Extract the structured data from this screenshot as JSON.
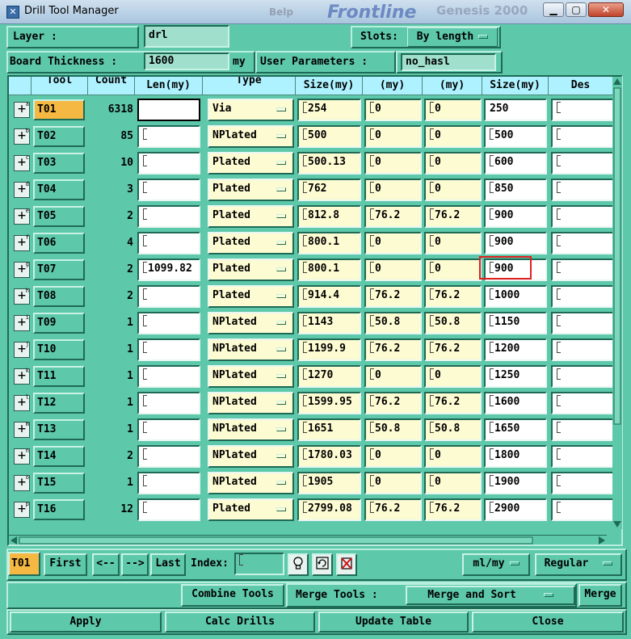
{
  "window": {
    "title": "Drill Tool Manager",
    "brand_small": "Belp",
    "brand": "Frontline",
    "brand2": "Genesis 2000"
  },
  "header": {
    "layer_label": "Layer          :",
    "layer_value": "drl",
    "slots_label": "Slots:",
    "slots_value": "By length",
    "thickness_label": "Board Thickness :",
    "thickness_value": "1600",
    "thickness_unit": "my",
    "user_params_label": "User Parameters :",
    "user_params_value": "no_hasl"
  },
  "table": {
    "headers": {
      "tool": "Tool",
      "count": "Count",
      "len": "Len(my)",
      "type": "Type",
      "size": "Size(my)",
      "tol1": "(my)",
      "tol2": "(my)",
      "finish": "Size(my)",
      "des": "Des"
    },
    "rows": [
      {
        "marker": "a",
        "tool": "T01",
        "count": "6318",
        "len": "",
        "type": "Via",
        "size": "254",
        "tol1": "0",
        "tol2": "0",
        "finish": "250",
        "des": ""
      },
      {
        "marker": "b",
        "tool": "T02",
        "count": "85",
        "len": "",
        "type": "NPlated",
        "size": "500",
        "tol1": "0",
        "tol2": "0",
        "finish": "500",
        "des": ""
      },
      {
        "marker": "c",
        "tool": "T03",
        "count": "10",
        "len": "",
        "type": "Plated",
        "size": "500.13",
        "tol1": "0",
        "tol2": "0",
        "finish": "600",
        "des": ""
      },
      {
        "marker": "d",
        "tool": "T04",
        "count": "3",
        "len": "",
        "type": "Plated",
        "size": "762",
        "tol1": "0",
        "tol2": "0",
        "finish": "850",
        "des": ""
      },
      {
        "marker": "e",
        "tool": "T05",
        "count": "2",
        "len": "",
        "type": "Plated",
        "size": "812.8",
        "tol1": "76.2",
        "tol2": "76.2",
        "finish": "900",
        "des": ""
      },
      {
        "marker": "f",
        "tool": "T06",
        "count": "4",
        "len": "",
        "type": "Plated",
        "size": "800.1",
        "tol1": "0",
        "tol2": "0",
        "finish": "900",
        "des": ""
      },
      {
        "marker": "g",
        "tool": "T07",
        "count": "2",
        "len": "1099.82",
        "type": "Plated",
        "size": "800.1",
        "tol1": "0",
        "tol2": "0",
        "finish": "900",
        "des": ""
      },
      {
        "marker": "h",
        "tool": "T08",
        "count": "2",
        "len": "",
        "type": "Plated",
        "size": "914.4",
        "tol1": "76.2",
        "tol2": "76.2",
        "finish": "1000",
        "des": ""
      },
      {
        "marker": "i",
        "tool": "T09",
        "count": "1",
        "len": "",
        "type": "NPlated",
        "size": "1143",
        "tol1": "50.8",
        "tol2": "50.8",
        "finish": "1150",
        "des": ""
      },
      {
        "marker": "j",
        "tool": "T10",
        "count": "1",
        "len": "",
        "type": "NPlated",
        "size": "1199.9",
        "tol1": "76.2",
        "tol2": "76.2",
        "finish": "1200",
        "des": ""
      },
      {
        "marker": "k",
        "tool": "T11",
        "count": "1",
        "len": "",
        "type": "NPlated",
        "size": "1270",
        "tol1": "0",
        "tol2": "0",
        "finish": "1250",
        "des": ""
      },
      {
        "marker": "l",
        "tool": "T12",
        "count": "1",
        "len": "",
        "type": "NPlated",
        "size": "1599.95",
        "tol1": "76.2",
        "tol2": "76.2",
        "finish": "1600",
        "des": ""
      },
      {
        "marker": "m",
        "tool": "T13",
        "count": "1",
        "len": "",
        "type": "NPlated",
        "size": "1651",
        "tol1": "50.8",
        "tol2": "50.8",
        "finish": "1650",
        "des": ""
      },
      {
        "marker": "n",
        "tool": "T14",
        "count": "2",
        "len": "",
        "type": "NPlated",
        "size": "1780.03",
        "tol1": "0",
        "tol2": "0",
        "finish": "1800",
        "des": ""
      },
      {
        "marker": "o",
        "tool": "T15",
        "count": "1",
        "len": "",
        "type": "NPlated",
        "size": "1905",
        "tol1": "0",
        "tol2": "0",
        "finish": "1900",
        "des": ""
      },
      {
        "marker": "p",
        "tool": "T16",
        "count": "12",
        "len": "",
        "type": "Plated",
        "size": "2799.08",
        "tol1": "76.2",
        "tol2": "76.2",
        "finish": "2900",
        "des": ""
      }
    ]
  },
  "nav": {
    "current_tool": "T01",
    "first": "First",
    "prev": "<--",
    "next": "-->",
    "last": "Last",
    "index_label": "Index:",
    "index_value": "",
    "units": "ml/my",
    "mode": "Regular"
  },
  "actions": {
    "combine_tools": "Combine Tools",
    "merge_tools_label": "Merge Tools :",
    "merge_option": "Merge and Sort",
    "merge": "Merge",
    "apply": "Apply",
    "calc_drills": "Calc Drills",
    "update_table": "Update Table",
    "close": "Close"
  },
  "colors": {
    "background": "#5ec8aa",
    "header": "#aef2ff",
    "selected_tool": "#f5b843",
    "cell_yellow": "#fdfbd2",
    "highlight": "#e02020"
  }
}
